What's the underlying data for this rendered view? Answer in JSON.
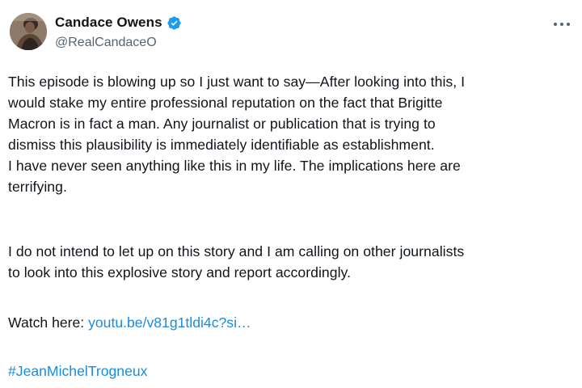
{
  "author": {
    "display_name": "Candace Owens",
    "handle": "@RealCandaceO",
    "verified": true,
    "verified_color": "#1d9bf0",
    "avatar_icon": "profile-photo"
  },
  "menu": {
    "more_icon": "more-horizontal-icon"
  },
  "tweet": {
    "paragraph_1": "This episode is blowing up so I just want to say—After looking into this, I\nwould stake my entire professional reputation on the fact that Brigitte\nMacron is in fact a man. Any journalist or publication that is trying to\ndismiss this plausibility is immediately identifiable as establishment.\nI have never seen anything like this in my life. The implications here are\nterrifying.",
    "paragraph_2": "I do not intend to let up on this story and I am calling on other journalists\nto look into this explosive story and report accordingly.",
    "watch_label": "Watch here: ",
    "watch_link": "youtu.be/v81g1tldi4c?si…",
    "hashtag": "#JeanMichelTrogneux"
  },
  "colors": {
    "text": "#0f1419",
    "secondary_text": "#536471",
    "link": "#1a8cd8"
  }
}
